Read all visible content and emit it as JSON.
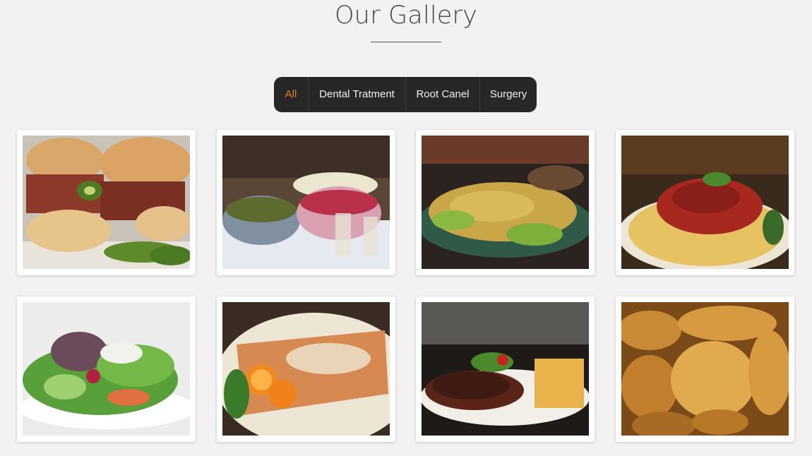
{
  "gallery": {
    "title": "Our Gallery",
    "filters": [
      {
        "label": "All",
        "active": true
      },
      {
        "label": "Dental Tratment",
        "active": false
      },
      {
        "label": "Root Canel",
        "active": false
      },
      {
        "label": "Surgery",
        "active": false
      }
    ],
    "accent_color": "#e0801f",
    "bar_color": "#272727"
  },
  "items": [
    {
      "subject": "burger-with-bacon-and-jalapeno"
    },
    {
      "subject": "bowls-of-olives-and-berries"
    },
    {
      "subject": "noodle-salad-plate"
    },
    {
      "subject": "pasta-with-tomato-sauce"
    },
    {
      "subject": "green-salad-plate"
    },
    {
      "subject": "crepe-with-orange-slices"
    },
    {
      "subject": "steak-with-fries"
    },
    {
      "subject": "croissants"
    }
  ]
}
